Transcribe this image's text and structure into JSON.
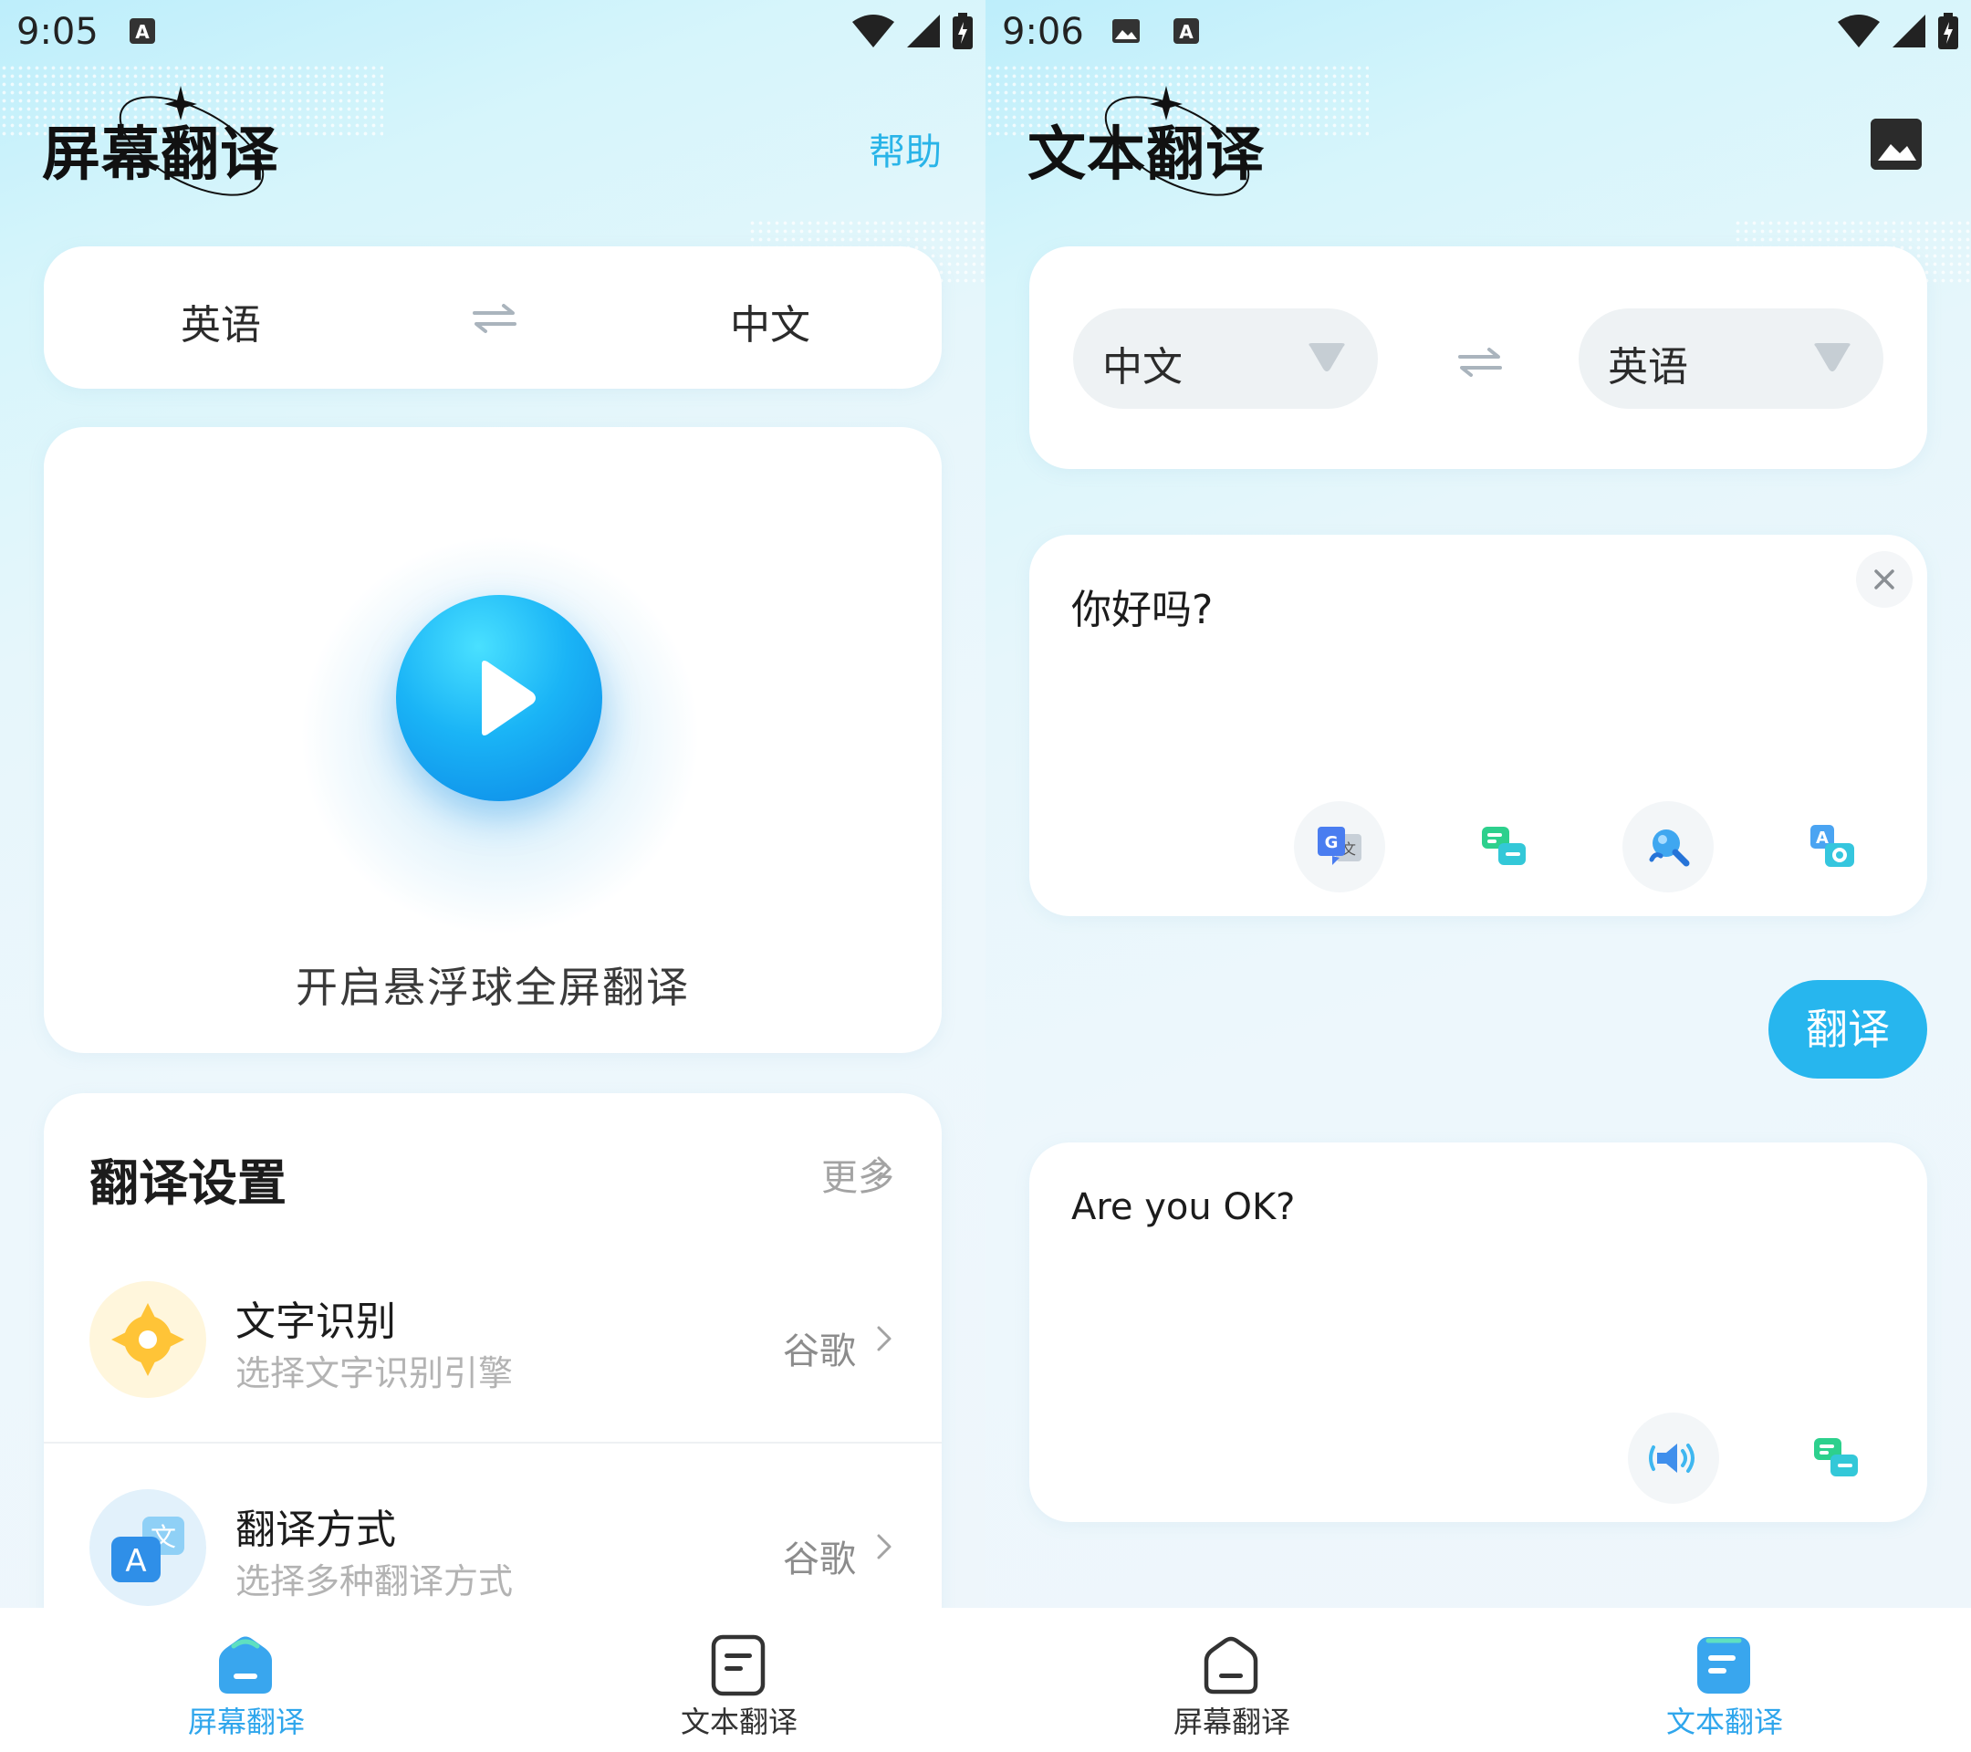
{
  "colors": {
    "accent": "#27b6ee",
    "nav_active": "#2fa6ec",
    "nav_inactive": "#333333",
    "muted": "#b3b3b3"
  },
  "left": {
    "status": {
      "time": "9:05"
    },
    "header": {
      "title": "屏幕翻译",
      "help": "帮助"
    },
    "languages": {
      "source": "英语",
      "target": "中文",
      "swap_icon": "swap-arrows-icon"
    },
    "float_ball": {
      "label": "开启悬浮球全屏翻译",
      "icon": "play-icon"
    },
    "settings": {
      "title": "翻译设置",
      "more": "更多",
      "items": [
        {
          "title": "文字识别",
          "subtitle": "选择文字识别引擎",
          "value": "谷歌",
          "icon": "ocr-target-icon"
        },
        {
          "title": "翻译方式",
          "subtitle": "选择多种翻译方式",
          "value": "谷歌",
          "icon": "translate-a-icon"
        }
      ]
    }
  },
  "right": {
    "status": {
      "time": "9:06"
    },
    "header": {
      "title": "文本翻译",
      "action_icon": "image-icon"
    },
    "languages": {
      "source": "中文",
      "target": "英语"
    },
    "input": {
      "text": "你好吗?",
      "tools": [
        "google-translate-icon",
        "chat-bubbles-icon",
        "search-magnifier-icon",
        "camera-translate-icon"
      ]
    },
    "translate_button": "翻译",
    "output": {
      "text": "Are you OK?",
      "tools": [
        "speaker-icon",
        "chat-bubbles-icon"
      ]
    }
  },
  "nav": {
    "items": [
      "屏幕翻译",
      "文本翻译"
    ]
  }
}
